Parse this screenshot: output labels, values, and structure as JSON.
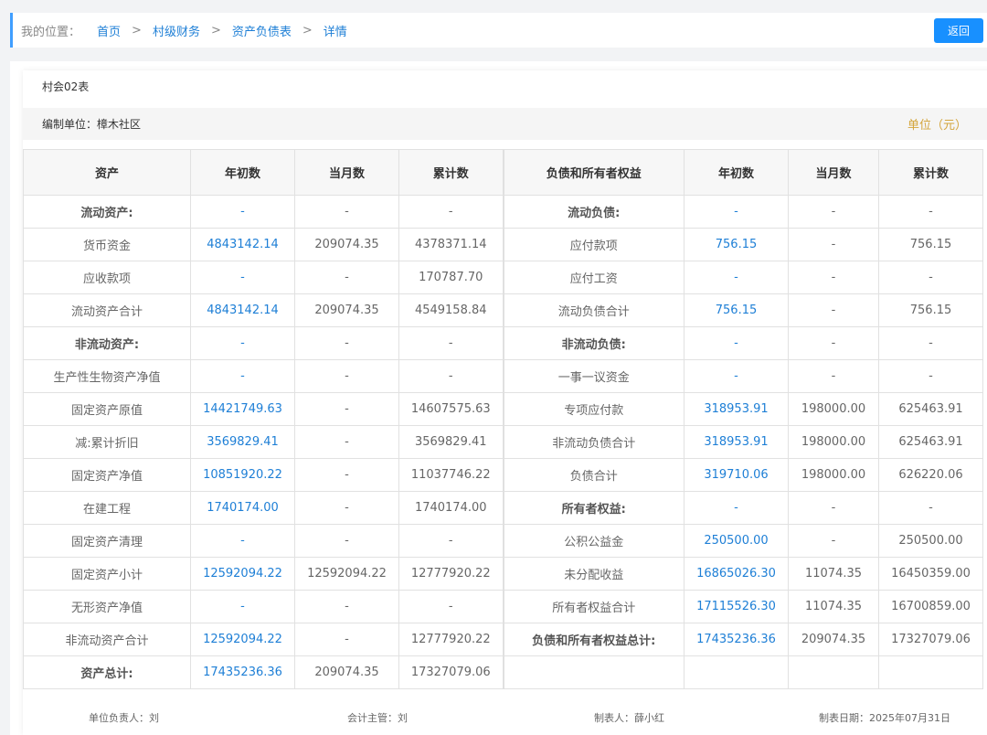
{
  "breadcrumb": {
    "lead": "我的位置：",
    "items": [
      "首页",
      "村级财务",
      "资产负债表",
      "详情"
    ],
    "sep": ">"
  },
  "back_button": "返回",
  "form_code": "村会02表",
  "org_label": "编制单位：樟木社区",
  "unit_label": "单位（元）",
  "columns": [
    "资产",
    "年初数",
    "当月数",
    "累计数",
    "负债和所有者权益",
    "年初数",
    "当月数",
    "累计数"
  ],
  "rows": [
    {
      "a": "流动资产:",
      "ab": 1,
      "b": "-",
      "c": "-",
      "d": "-",
      "e": "流动负债:",
      "eb": 1,
      "f": "-",
      "g": "-",
      "h": "-"
    },
    {
      "a": "货币资金",
      "ab": 0,
      "b": "4843142.14",
      "c": "209074.35",
      "d": "4378371.14",
      "e": "应付款项",
      "eb": 0,
      "f": "756.15",
      "g": "-",
      "h": "756.15"
    },
    {
      "a": "应收款项",
      "ab": 0,
      "b": "-",
      "c": "-",
      "d": "170787.70",
      "e": "应付工资",
      "eb": 0,
      "f": "-",
      "g": "-",
      "h": "-"
    },
    {
      "a": "流动资产合计",
      "ab": 0,
      "b": "4843142.14",
      "c": "209074.35",
      "d": "4549158.84",
      "e": "流动负债合计",
      "eb": 0,
      "f": "756.15",
      "g": "-",
      "h": "756.15"
    },
    {
      "a": "非流动资产:",
      "ab": 1,
      "b": "-",
      "c": "-",
      "d": "-",
      "e": "非流动负债:",
      "eb": 1,
      "f": "-",
      "g": "-",
      "h": "-"
    },
    {
      "a": "生产性生物资产净值",
      "ab": 0,
      "b": "-",
      "c": "-",
      "d": "-",
      "e": "一事一议资金",
      "eb": 0,
      "f": "-",
      "g": "-",
      "h": "-"
    },
    {
      "a": "固定资产原值",
      "ab": 0,
      "b": "14421749.63",
      "c": "-",
      "d": "14607575.63",
      "e": "专项应付款",
      "eb": 0,
      "f": "318953.91",
      "g": "198000.00",
      "h": "625463.91"
    },
    {
      "a": "减:累计折旧",
      "ab": 0,
      "b": "3569829.41",
      "c": "-",
      "d": "3569829.41",
      "e": "非流动负债合计",
      "eb": 0,
      "f": "318953.91",
      "g": "198000.00",
      "h": "625463.91"
    },
    {
      "a": "固定资产净值",
      "ab": 0,
      "b": "10851920.22",
      "c": "-",
      "d": "11037746.22",
      "e": "负债合计",
      "eb": 0,
      "f": "319710.06",
      "g": "198000.00",
      "h": "626220.06"
    },
    {
      "a": "在建工程",
      "ab": 0,
      "b": "1740174.00",
      "c": "-",
      "d": "1740174.00",
      "e": "所有者权益:",
      "eb": 1,
      "f": "-",
      "g": "-",
      "h": "-"
    },
    {
      "a": "固定资产清理",
      "ab": 0,
      "b": "-",
      "c": "-",
      "d": "-",
      "e": "公积公益金",
      "eb": 0,
      "f": "250500.00",
      "g": "-",
      "h": "250500.00"
    },
    {
      "a": "固定资产小计",
      "ab": 0,
      "b": "12592094.22",
      "c": "12592094.22",
      "d": "12777920.22",
      "e": "未分配收益",
      "eb": 0,
      "f": "16865026.30",
      "g": "11074.35",
      "h": "16450359.00"
    },
    {
      "a": "无形资产净值",
      "ab": 0,
      "b": "-",
      "c": "-",
      "d": "-",
      "e": "所有者权益合计",
      "eb": 0,
      "f": "17115526.30",
      "g": "11074.35",
      "h": "16700859.00"
    },
    {
      "a": "非流动资产合计",
      "ab": 0,
      "b": "12592094.22",
      "c": "-",
      "d": "12777920.22",
      "e": "负债和所有者权益总计:",
      "eb": 1,
      "f": "17435236.36",
      "g": "209074.35",
      "h": "17327079.06"
    },
    {
      "a": "资产总计:",
      "ab": 1,
      "b": "17435236.36",
      "c": "209074.35",
      "d": "17327079.06",
      "e": "",
      "eb": 0,
      "f": "",
      "g": "",
      "h": ""
    }
  ],
  "footer": {
    "head": "单位负责人：刘",
    "accountant": "会计主管：刘",
    "preparer": "制表人：薛小红",
    "date": "制表日期：2025年07月31日"
  }
}
